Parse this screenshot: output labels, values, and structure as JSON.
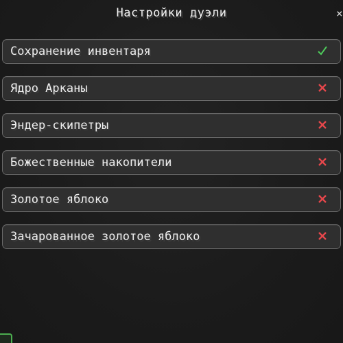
{
  "window": {
    "title": "Настройки дуэли",
    "close_glyph": "×"
  },
  "options": [
    {
      "label": "Сохранение инвентаря",
      "enabled": true,
      "icon": "checkmark-icon"
    },
    {
      "label": "Ядро Арканы",
      "enabled": false,
      "icon": "cross-icon"
    },
    {
      "label": "Эндер-скипетры",
      "enabled": false,
      "icon": "cross-icon"
    },
    {
      "label": "Божественные накопители",
      "enabled": false,
      "icon": "cross-icon"
    },
    {
      "label": "Золотое яблоко",
      "enabled": false,
      "icon": "cross-icon"
    },
    {
      "label": "Зачарованное золотое яблоко",
      "enabled": false,
      "icon": "cross-icon"
    }
  ],
  "colors": {
    "enabled": "#4ecb5b",
    "disabled": "#e5474b",
    "accent_corner": "#4caf50"
  }
}
